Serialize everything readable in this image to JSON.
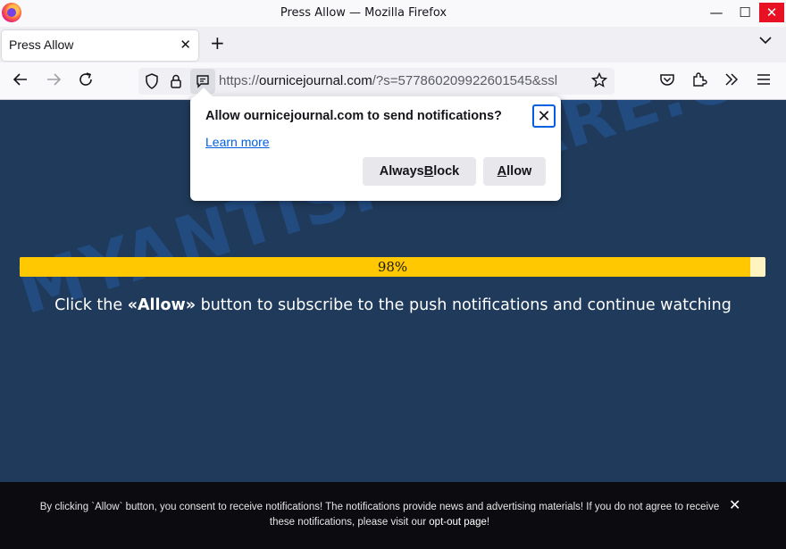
{
  "window": {
    "title": "Press Allow — Mozilla Firefox",
    "minimize": "—",
    "maximize": "☐",
    "close": "✕"
  },
  "tab": {
    "title": "Press Allow",
    "close": "✕",
    "new_tab": "+",
    "list_tabs": "⌄"
  },
  "urlbar": {
    "scheme": "https://",
    "host": "ournicejournal.com",
    "path": "/?s=577860209922601545&ssl"
  },
  "popup": {
    "title": "Allow ournicejournal.com to send notifications?",
    "learn_more": "Learn more",
    "block_label_pre": "Always ",
    "block_label_key": "B",
    "block_label_post": "lock",
    "allow_label_key": "A",
    "allow_label_post": "llow",
    "close": "✕"
  },
  "page": {
    "progress_fraction": 0.98,
    "progress_label": "98%",
    "cta_pre": "Click the ",
    "cta_bold": "«Allow»",
    "cta_post": " button to subscribe to the push notifications and continue watching",
    "watermark": "MYANTISPYWARE.COM"
  },
  "consent": {
    "text": "By clicking `Allow` button, you consent to receive notifications! The notifications provide news and advertising materials! If you do not agree to receive these notifications, please visit our ",
    "link": "opt-out page",
    "text_end": "!",
    "close": "✕"
  },
  "colors": {
    "page_bg": "#1f3a5a",
    "progress_fill": "#ffc800",
    "progress_track": "#fff3c0",
    "focus": "#0060df",
    "close_red": "#e81123"
  }
}
